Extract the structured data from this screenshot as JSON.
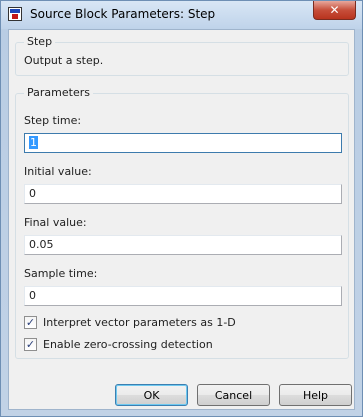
{
  "window": {
    "title": "Source Block Parameters: Step",
    "close_glyph": "✕"
  },
  "block": {
    "group_title": "Step",
    "description": "Output a step."
  },
  "parameters": {
    "group_title": "Parameters",
    "step_time": {
      "label": "Step time:",
      "value": "1"
    },
    "initial_value": {
      "label": "Initial value:",
      "value": "0"
    },
    "final_value": {
      "label": "Final value:",
      "value": "0.05"
    },
    "sample_time": {
      "label": "Sample time:",
      "value": "0"
    },
    "interpret_vector": {
      "label": "Interpret vector parameters as 1-D",
      "checked": true
    },
    "zero_crossing": {
      "label": "Enable zero-crossing detection",
      "checked": true
    }
  },
  "buttons": {
    "ok": "OK",
    "cancel": "Cancel",
    "help": "Help"
  },
  "icons": {
    "app": "simulink-block-icon",
    "close": "close-icon",
    "check": "checkmark-icon"
  }
}
